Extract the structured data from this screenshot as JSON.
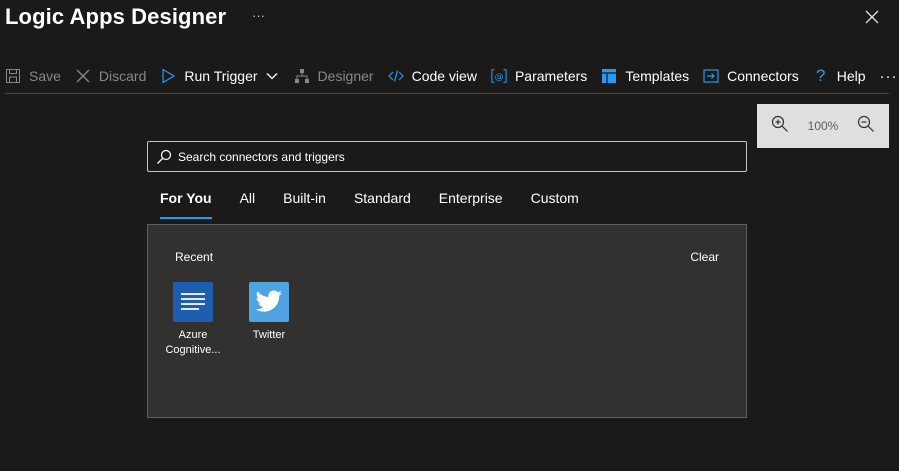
{
  "window": {
    "title": "Logic Apps Designer",
    "title_more": "···",
    "close_icon": "close-icon"
  },
  "toolbar": {
    "items": [
      {
        "label": "Save",
        "icon": "save-icon",
        "enabled": false
      },
      {
        "label": "Discard",
        "icon": "discard-icon",
        "enabled": false
      },
      {
        "label": "Run Trigger",
        "icon": "play-icon",
        "enabled": true
      },
      {
        "label": "Designer",
        "icon": "designer-icon",
        "enabled": false
      },
      {
        "label": "Code view",
        "icon": "code-icon",
        "enabled": true
      },
      {
        "label": "Parameters",
        "icon": "parameters-icon",
        "enabled": true
      },
      {
        "label": "Templates",
        "icon": "templates-icon",
        "enabled": true
      },
      {
        "label": "Connectors",
        "icon": "connectors-icon",
        "enabled": true
      },
      {
        "label": "Help",
        "icon": "help-icon",
        "enabled": true
      }
    ],
    "more": "···"
  },
  "zoom": {
    "level": "100%"
  },
  "search": {
    "placeholder": "Search connectors and triggers"
  },
  "tabs": [
    {
      "label": "For You",
      "active": true
    },
    {
      "label": "All",
      "active": false
    },
    {
      "label": "Built-in",
      "active": false
    },
    {
      "label": "Standard",
      "active": false
    },
    {
      "label": "Enterprise",
      "active": false
    },
    {
      "label": "Custom",
      "active": false
    }
  ],
  "recent": {
    "heading": "Recent",
    "clear_label": "Clear",
    "items": [
      {
        "label_line1": "Azure",
        "label_line2": "Cognitive...",
        "icon": "azure-cognitive-icon",
        "color": "#1f5eaf"
      },
      {
        "label_line1": "Twitter",
        "label_line2": "",
        "icon": "twitter-icon",
        "color": "#4fa3e0"
      }
    ]
  },
  "colors": {
    "accent": "#2899f5",
    "background": "#1b1a19",
    "panel": "#323130"
  }
}
